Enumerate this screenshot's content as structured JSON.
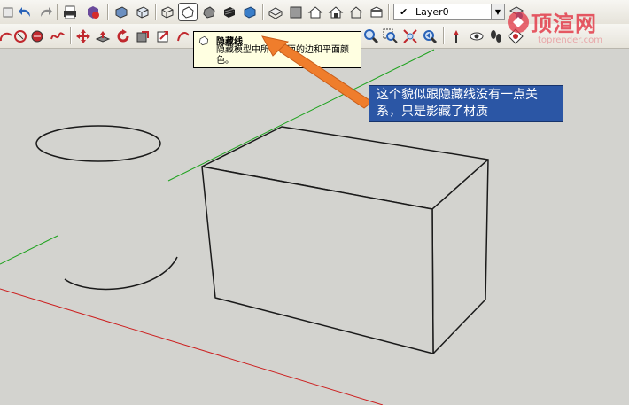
{
  "toolbar": {
    "layer": {
      "checked_icon": "checkmark-icon",
      "value": "Layer0"
    },
    "row1_icons": [
      "undo-icon",
      "redo-icon",
      "print-icon",
      "model-info-icon",
      "wireframe-style-icon",
      "hidden-line-style-icon",
      "shaded-style-icon",
      "shaded-textures-style-icon",
      "monochrome-style-icon",
      "xray-style-icon",
      "iso-view-icon",
      "top-view-icon",
      "front-view-icon",
      "right-view-icon",
      "back-view-icon",
      "left-view-icon",
      "layer-manager-icon"
    ],
    "row2_icons": [
      "arc-icon",
      "rotated-rectangle-icon",
      "circle-icon",
      "freehand-icon",
      "move-icon",
      "pushpull-icon",
      "rotate-icon",
      "followme-icon",
      "scale-icon",
      "offset-icon",
      "tape-measure-icon",
      "zoom-icon",
      "zoom-extents-icon",
      "zoom-window-icon",
      "position-camera-icon",
      "look-around-icon",
      "walk-icon",
      "orbit-icon"
    ]
  },
  "tooltip": {
    "title": "隐藏线",
    "description": "隐藏模型中所有背面的边和平面颜色。"
  },
  "callout": {
    "text": "这个貌似跟隐藏线没有一点关系，只是影藏了材质"
  },
  "watermark": {
    "title": "顶渲网",
    "subtitle": "toprender.com"
  },
  "colors": {
    "viewport_bg": "#d3d3cf",
    "green_axis": "#1fa31f",
    "red_axis": "#cc1f1f",
    "arrow": "#ef7d2c",
    "callout_bg": "#2b56a5",
    "tooltip_bg": "#ffffe1"
  }
}
